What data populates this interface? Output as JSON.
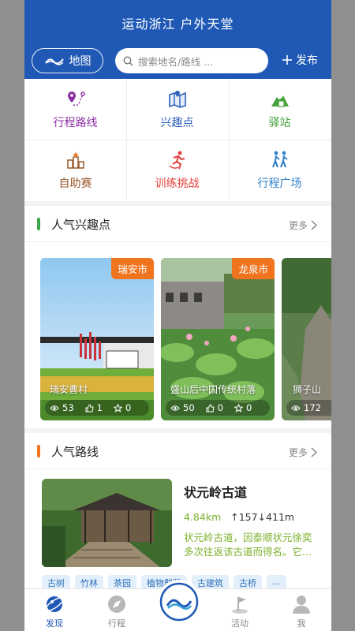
{
  "header": {
    "title": "运动浙江 户外天堂",
    "map_label": "地图",
    "search_placeholder": "搜索地名/路线 ...",
    "publish_label": "发布"
  },
  "categories": [
    {
      "label": "行程路线",
      "color": "#8e2ea3",
      "icon": "route-pin-icon"
    },
    {
      "label": "兴趣点",
      "color": "#2b5fb8",
      "icon": "map-icon"
    },
    {
      "label": "驿站",
      "color": "#45a23c",
      "icon": "station-icon"
    },
    {
      "label": "自助赛",
      "color": "#9a5a2b",
      "icon": "podium-icon"
    },
    {
      "label": "训练挑战",
      "color": "#e0413a",
      "icon": "runner-icon"
    },
    {
      "label": "行程广场",
      "color": "#2b7fc8",
      "icon": "hikers-icon"
    }
  ],
  "poi_section": {
    "title": "人气兴趣点",
    "more": "更多",
    "bar_color": "#3aa748",
    "cards": [
      {
        "tag": "瑞安市",
        "name": "瑞安曹村",
        "views": "53",
        "likes": "1",
        "favs": "0"
      },
      {
        "tag": "龙泉市",
        "name": "盛山后中国传统村落",
        "views": "50",
        "likes": "0",
        "favs": "0"
      },
      {
        "tag": "",
        "name": "狮子山",
        "views": "172",
        "likes": "",
        "favs": ""
      }
    ]
  },
  "route_section": {
    "title": "人气路线",
    "more": "更多",
    "bar_color": "#f0731d",
    "route": {
      "title": "状元岭古道",
      "distance": "4.84km",
      "elevation": "↑157↓411m",
      "description": "状元岭古道，因泰顺状元徐奕多次往返该古道而得名。它...",
      "tags": [
        "古树",
        "竹林",
        "茶园",
        "植物群落",
        "古建筑",
        "古桥",
        "..."
      ]
    }
  },
  "tabbar": {
    "tabs": [
      {
        "label": "发现",
        "active": true
      },
      {
        "label": "行程",
        "active": false
      },
      {
        "label": "活动",
        "active": false
      },
      {
        "label": "我",
        "active": false
      }
    ]
  }
}
